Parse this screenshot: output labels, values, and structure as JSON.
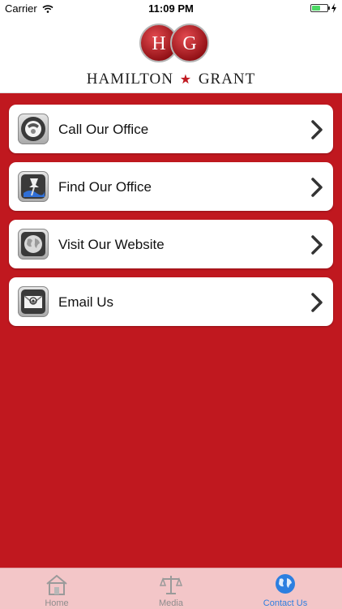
{
  "status_bar": {
    "carrier": "Carrier",
    "time": "11:09 PM",
    "battery_level": 0.55
  },
  "brand": {
    "monogram": "HG",
    "left_name": "HAMILTON",
    "right_name": "GRANT"
  },
  "menu": {
    "items": [
      {
        "label": "Call Our Office",
        "icon": "phone-icon"
      },
      {
        "label": "Find Our Office",
        "icon": "map-pin-icon"
      },
      {
        "label": "Visit Our Website",
        "icon": "globe-icon"
      },
      {
        "label": "Email Us",
        "icon": "email-icon"
      }
    ]
  },
  "tabs": [
    {
      "label": "Home",
      "icon": "home-icon"
    },
    {
      "label": "Media",
      "icon": "scales-icon"
    },
    {
      "label": "Contact Us",
      "icon": "globe-icon",
      "active": true
    }
  ],
  "colors": {
    "primary": "#c0181f",
    "tab_active": "#2d7fe0",
    "tab_bar": "#f3c6c8"
  }
}
